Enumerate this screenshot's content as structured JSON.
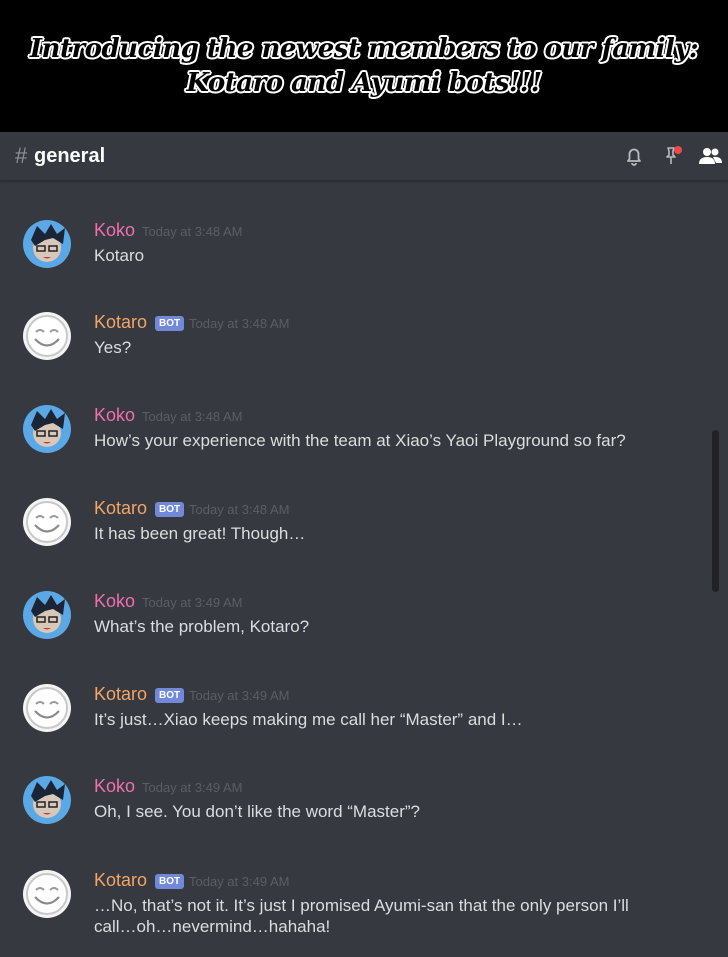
{
  "banner": {
    "line1": "Introducing the newest members to our family:",
    "line2": "Kotaro and Ayumi bots!!!"
  },
  "header": {
    "hash": "#",
    "channel": "general",
    "icons": [
      "bell-icon",
      "pin-icon",
      "members-icon"
    ]
  },
  "colors": {
    "koko": "#f06fae",
    "kotaro": "#f2a567",
    "bot_tag": "#7289da",
    "background": "#36393f",
    "text": "#dcddde",
    "timestamp": "#5b5e63"
  },
  "messages": [
    {
      "user": "Koko",
      "bot": false,
      "time": "Today at 3:48 AM",
      "text": "Kotaro"
    },
    {
      "user": "Kotaro",
      "bot": true,
      "bot_label": "BOT",
      "time": "Today at 3:48 AM",
      "text": "Yes?"
    },
    {
      "user": "Koko",
      "bot": false,
      "time": "Today at 3:48 AM",
      "text": "How’s your experience with the team at Xiao’s Yaoi Playground so far?"
    },
    {
      "user": "Kotaro",
      "bot": true,
      "bot_label": "BOT",
      "time": "Today at 3:48 AM",
      "text": "It has been great! Though…"
    },
    {
      "user": "Koko",
      "bot": false,
      "time": "Today at 3:49 AM",
      "text": "What’s the problem, Kotaro?"
    },
    {
      "user": "Kotaro",
      "bot": true,
      "bot_label": "BOT",
      "time": "Today at 3:49 AM",
      "text": "It’s just…Xiao keeps making me call her “Master” and I…"
    },
    {
      "user": "Koko",
      "bot": false,
      "time": "Today at 3:49 AM",
      "text": "Oh, I see. You don’t like the word “Master”?"
    },
    {
      "user": "Kotaro",
      "bot": true,
      "bot_label": "BOT",
      "time": "Today at 3:49 AM",
      "text": "…No, that’s not it. It’s just I promised Ayumi-san that the only person I’ll call…oh…nevermind…hahaha!"
    }
  ]
}
